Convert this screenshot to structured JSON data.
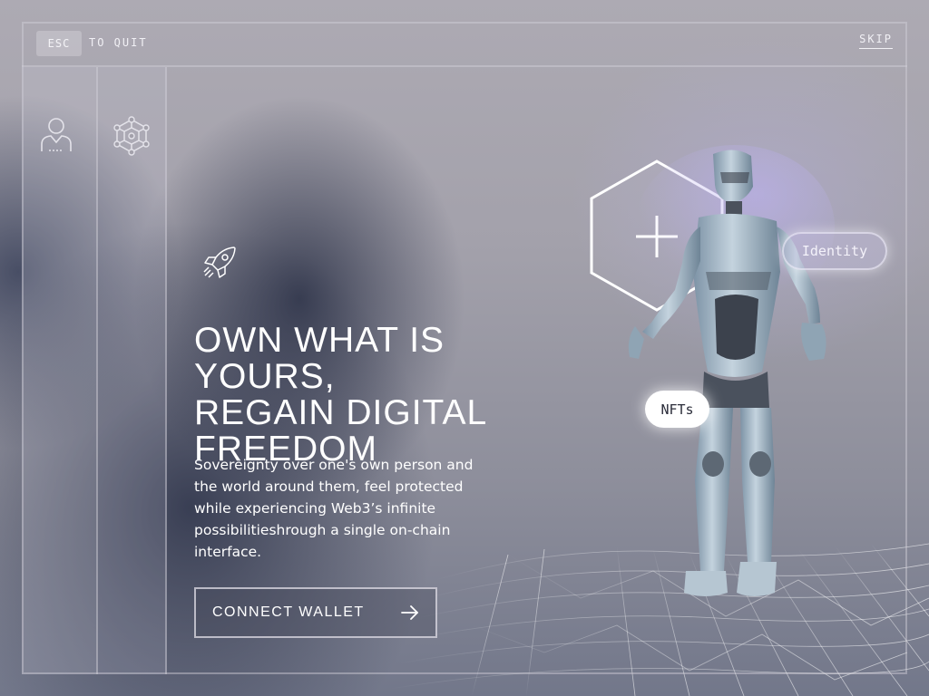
{
  "topbar": {
    "esc_key": "ESC",
    "quit_label": "TO QUIT",
    "skip_label": "SKIP"
  },
  "sidebar": {
    "icons": [
      "user-icon",
      "network-cube-icon"
    ]
  },
  "hero": {
    "icon": "rocket-icon",
    "headline_lines": [
      "OWN WHAT IS YOURS,",
      "REGAIN DIGITAL",
      "FREEDOM"
    ],
    "body": "Sovereignty over one's own person and the world around them, feel protected while experiencing Web3’s infinite possibilitieshrough a single on-chain interface.",
    "cta_label": "CONNECT WALLET",
    "cta_icon": "arrow-right-icon"
  },
  "scene": {
    "add_icon": "plus-icon",
    "tags": {
      "identity": "Identity",
      "nfts": "NFTs"
    }
  },
  "colors": {
    "text": "#ffffff",
    "frame": "#d2d0da",
    "robot": "#a9bccb"
  }
}
